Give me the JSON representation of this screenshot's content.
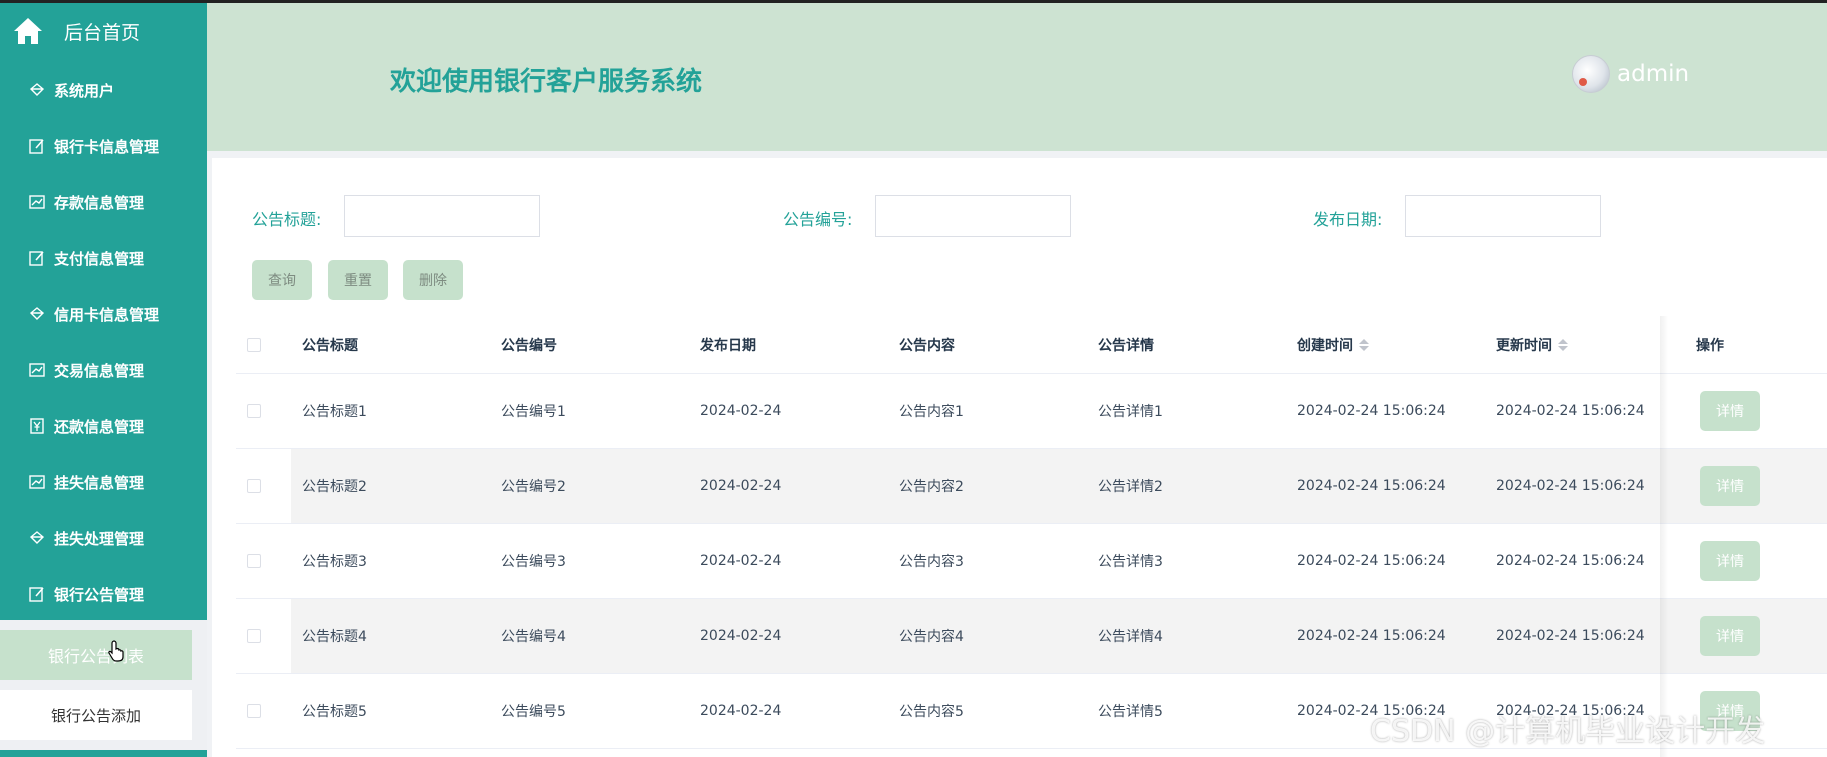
{
  "sidebar": {
    "home_label": "后台首页",
    "items": [
      {
        "label": "系统用户",
        "icon": "diamond-icon"
      },
      {
        "label": "银行卡信息管理",
        "icon": "edit-icon"
      },
      {
        "label": "存款信息管理",
        "icon": "chart-icon"
      },
      {
        "label": "支付信息管理",
        "icon": "edit-icon"
      },
      {
        "label": "信用卡信息管理",
        "icon": "diamond-icon"
      },
      {
        "label": "交易信息管理",
        "icon": "chart-icon"
      },
      {
        "label": "还款信息管理",
        "icon": "yen-icon"
      },
      {
        "label": "挂失信息管理",
        "icon": "chart-icon"
      },
      {
        "label": "挂失处理管理",
        "icon": "diamond-icon"
      },
      {
        "label": "银行公告管理",
        "icon": "edit-icon"
      }
    ],
    "submenu": {
      "list_label": "银行公告列表",
      "add_label": "银行公告添加"
    }
  },
  "header": {
    "title": "欢迎使用银行客户服务系统",
    "username": "admin"
  },
  "filters": [
    {
      "label": "公告标题:",
      "value": ""
    },
    {
      "label": "公告编号:",
      "value": ""
    },
    {
      "label": "发布日期:",
      "value": ""
    }
  ],
  "buttons": {
    "query": "查询",
    "reset": "重置",
    "delete": "删除"
  },
  "table": {
    "columns": [
      "公告标题",
      "公告编号",
      "发布日期",
      "公告内容",
      "公告详情",
      "创建时间",
      "更新时间",
      "操作"
    ],
    "rows": [
      [
        "公告标题1",
        "公告编号1",
        "2024-02-24",
        "公告内容1",
        "公告详情1",
        "2024-02-24 15:06:24",
        "2024-02-24 15:06:24"
      ],
      [
        "公告标题2",
        "公告编号2",
        "2024-02-24",
        "公告内容2",
        "公告详情2",
        "2024-02-24 15:06:24",
        "2024-02-24 15:06:24"
      ],
      [
        "公告标题3",
        "公告编号3",
        "2024-02-24",
        "公告内容3",
        "公告详情3",
        "2024-02-24 15:06:24",
        "2024-02-24 15:06:24"
      ],
      [
        "公告标题4",
        "公告编号4",
        "2024-02-24",
        "公告内容4",
        "公告详情4",
        "2024-02-24 15:06:24",
        "2024-02-24 15:06:24"
      ],
      [
        "公告标题5",
        "公告编号5",
        "2024-02-24",
        "公告内容5",
        "公告详情5",
        "2024-02-24 15:06:24",
        "2024-02-24 15:06:24"
      ]
    ],
    "action_label": "详情"
  },
  "watermark": "CSDN @计算机毕业设计开发",
  "colors": {
    "primary": "#23a298",
    "header_bg": "#cde3d2",
    "button_bg": "#c6e1cc"
  }
}
